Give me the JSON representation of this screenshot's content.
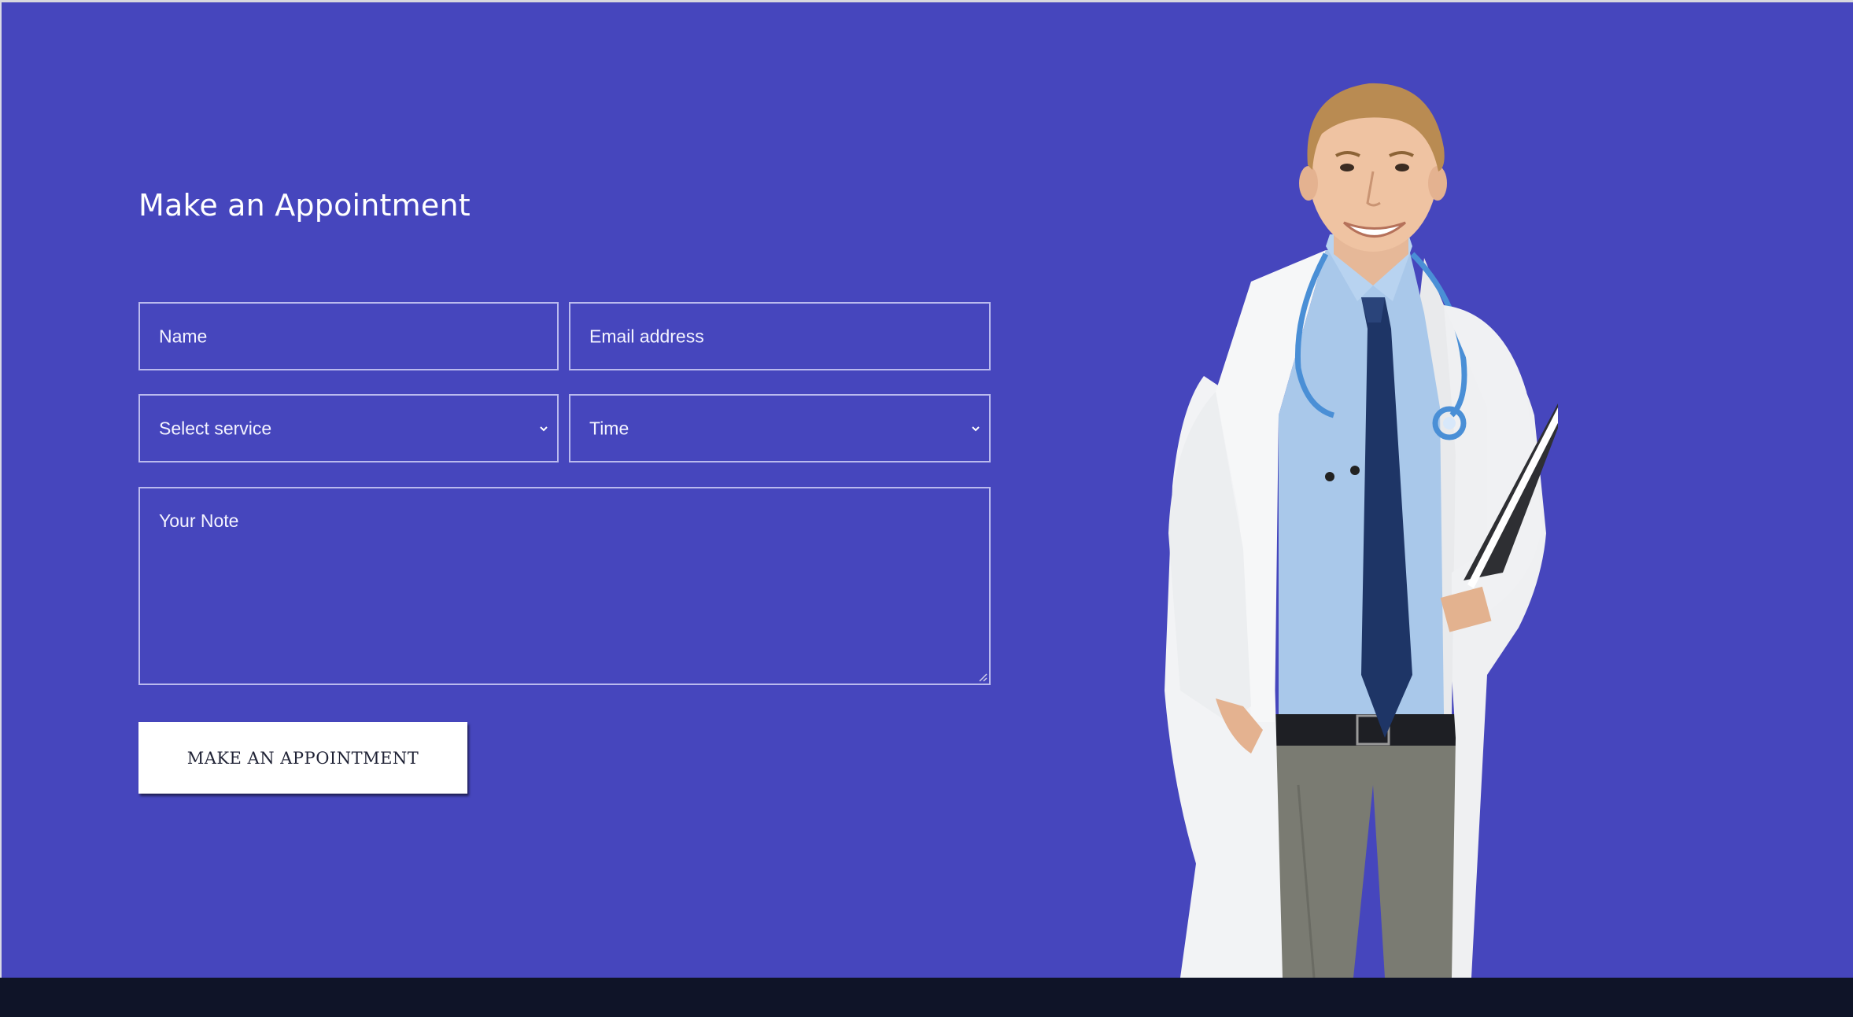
{
  "form": {
    "title": "Make an Appointment",
    "name_placeholder": "Name",
    "email_placeholder": "Email address",
    "service_selected": "Select service",
    "time_selected": "Time",
    "note_placeholder": "Your Note",
    "submit_label": "MAKE AN APPOINTMENT"
  },
  "icons": {
    "service_dropdown": "chevron-down-icon",
    "time_dropdown": "chevron-down-icon",
    "note_resize": "resize-grip-icon"
  },
  "colors": {
    "background": "#4646bd",
    "footer": "#0f1428",
    "button_bg": "#ffffff",
    "button_text": "#1f2235"
  }
}
